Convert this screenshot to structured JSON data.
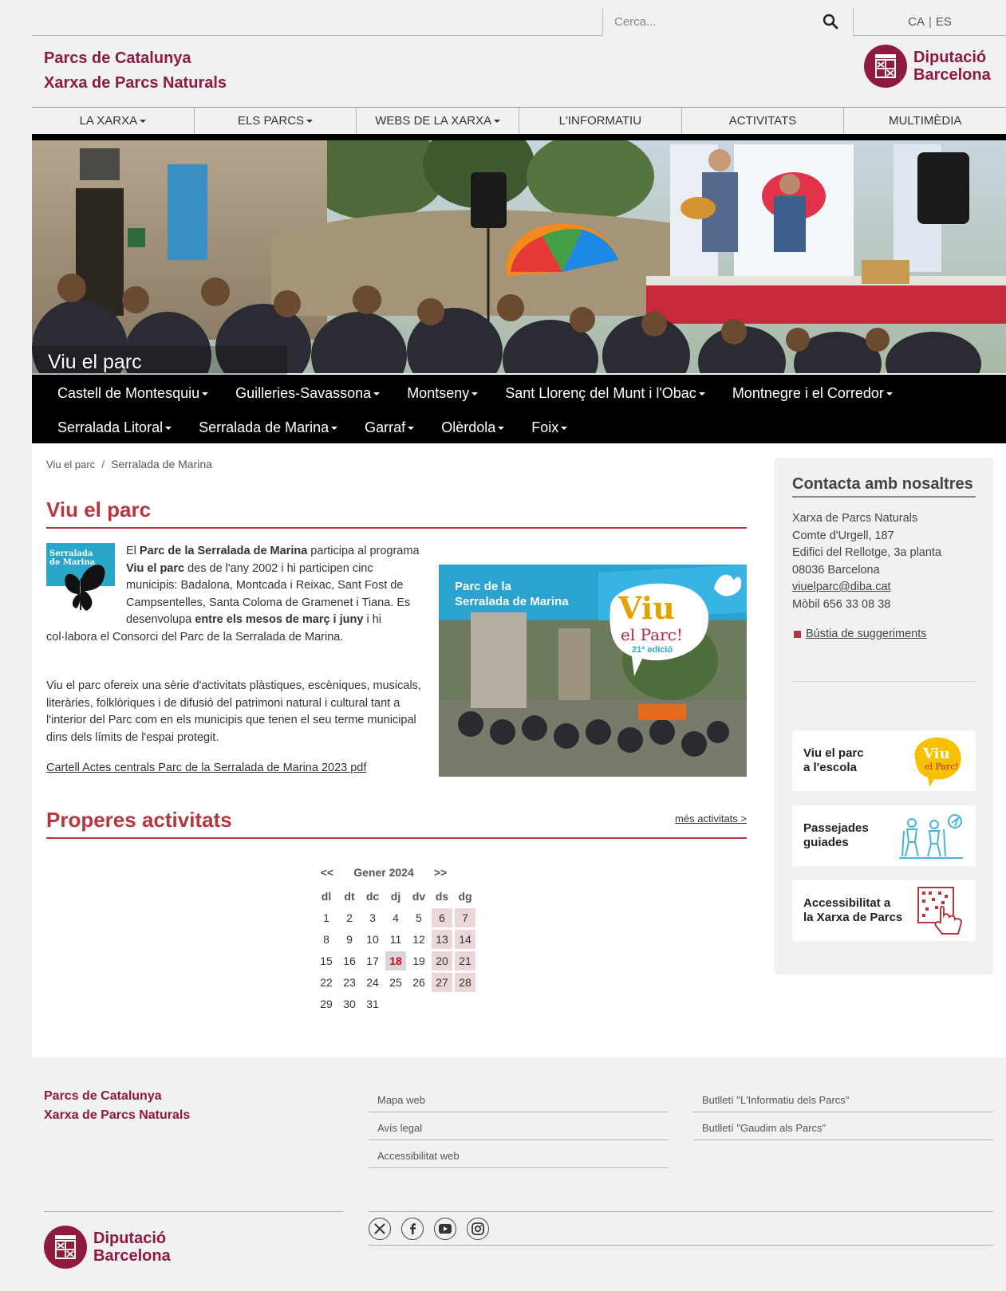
{
  "search": {
    "placeholder": "Cerca..."
  },
  "languages": {
    "ca": "CA",
    "es": "ES"
  },
  "brand": {
    "line1": "Parcs de Catalunya",
    "line2": "Xarxa de Parcs Naturals"
  },
  "diputacio": {
    "line1": "Diputació",
    "line2": "Barcelona"
  },
  "main_nav": [
    {
      "label": "LA XARXA",
      "dropdown": true
    },
    {
      "label": "ELS PARCS",
      "dropdown": true
    },
    {
      "label": "WEBS DE LA XARXA",
      "dropdown": true
    },
    {
      "label": "L'INFORMATIU",
      "dropdown": false
    },
    {
      "label": "ACTIVITATS",
      "dropdown": false
    },
    {
      "label": "MULTIMÈDIA",
      "dropdown": false
    }
  ],
  "hero": {
    "title": "Viu el parc"
  },
  "parks_nav": {
    "row1": [
      "Castell de Montesquiu",
      "Guilleries-Savassona",
      "Montseny",
      "Sant Llorenç del Munt i l'Obac",
      "Montnegre i el Corredor"
    ],
    "row2": [
      "Serralada Litoral",
      "Serralada de Marina",
      "Garraf",
      "Olèrdola",
      "Foix"
    ]
  },
  "breadcrumb": {
    "first": "Viu el parc",
    "separator": "/",
    "current": "Serralada de Marina"
  },
  "page_title": "Viu el parc",
  "park_badge": {
    "line1": "Serralada",
    "line2": "de Marina"
  },
  "intro": {
    "t1": "El ",
    "b1": "Parc de la Serralada de Marina",
    "t2": " participa al programa ",
    "b2": "Viu el parc",
    "t3": " des de l'any 2002 i hi participen cinc municipis: Badalona, Montcada i Reixac, Sant Fost de Campsentelles, Santa Coloma de Gramenet i Tiana. Es desenvolupa ",
    "b3": "entre els mesos de març i juny",
    "t4": " i hi col·labora el Consorci del Parc de la Serralada de Marina."
  },
  "para2": "Viu el parc ofereix una sèrie d'activitats plàstiques, escèniques, musicals, literàries, folklòriques i de difusió del patrimoni natural i cultural tant a l'interior del Parc com en els municipis que tenen el seu terme municipal dins dels límits de l'espai protegit.",
  "poster_link": "Cartell Actes centrals Parc de la Serralada de Marina 2023 pdf",
  "poster": {
    "title1": "Parc de la",
    "title2": "Serralada de Marina",
    "viu": "Viu",
    "el_parc": "el Parc!",
    "edition": "21ª edició"
  },
  "activities": {
    "title": "Properes activitats",
    "more": "més activitats >"
  },
  "calendar": {
    "prev": "<<",
    "next": ">>",
    "month": "Gener 2024",
    "weekdays": [
      "dl",
      "dt",
      "dc",
      "dj",
      "dv",
      "ds",
      "dg"
    ],
    "weeks": [
      [
        "1",
        "2",
        "3",
        "4",
        "5",
        "6",
        "7"
      ],
      [
        "8",
        "9",
        "10",
        "11",
        "12",
        "13",
        "14"
      ],
      [
        "15",
        "16",
        "17",
        "18",
        "19",
        "20",
        "21"
      ],
      [
        "22",
        "23",
        "24",
        "25",
        "26",
        "27",
        "28"
      ],
      [
        "29",
        "30",
        "31",
        "",
        "",
        "",
        ""
      ]
    ],
    "today": "18"
  },
  "contact": {
    "title": "Contacta amb nosaltres",
    "lines": [
      "Xarxa de Parcs Naturals",
      "Comte d'Urgell, 187",
      "Edifici del Rellotge, 3a planta",
      "08036 Barcelona"
    ],
    "email": "viuelparc@diba.cat",
    "mobile": "Mòbil 656 33 08 38",
    "suggestions": "Bústia de suggeriments"
  },
  "side_cards": {
    "escola": "Viu el parc\na l'escola",
    "escola_badge": "Viu",
    "escola_badge2": "el Parc!",
    "passejades": "Passejades\nguiades",
    "access": "Accessibilitat a\nla Xarxa de Parcs"
  },
  "footer": {
    "brand1": "Parcs de Catalunya",
    "brand2": "Xarxa de Parcs Naturals",
    "col1": [
      "Mapa web",
      "Avís legal",
      "Accessibilitat web"
    ],
    "col2": [
      "Butlletí \"L'Informatiu dels Parcs\"",
      "Butlletí \"Gaudim als Parcs\""
    ]
  },
  "social_icons": [
    "x-icon",
    "facebook-icon",
    "youtube-icon",
    "instagram-icon"
  ],
  "colors": {
    "brand": "#8e1a3c",
    "accent": "#b6363f",
    "weekend": "#ecd7d8",
    "today": "#e0001a"
  }
}
